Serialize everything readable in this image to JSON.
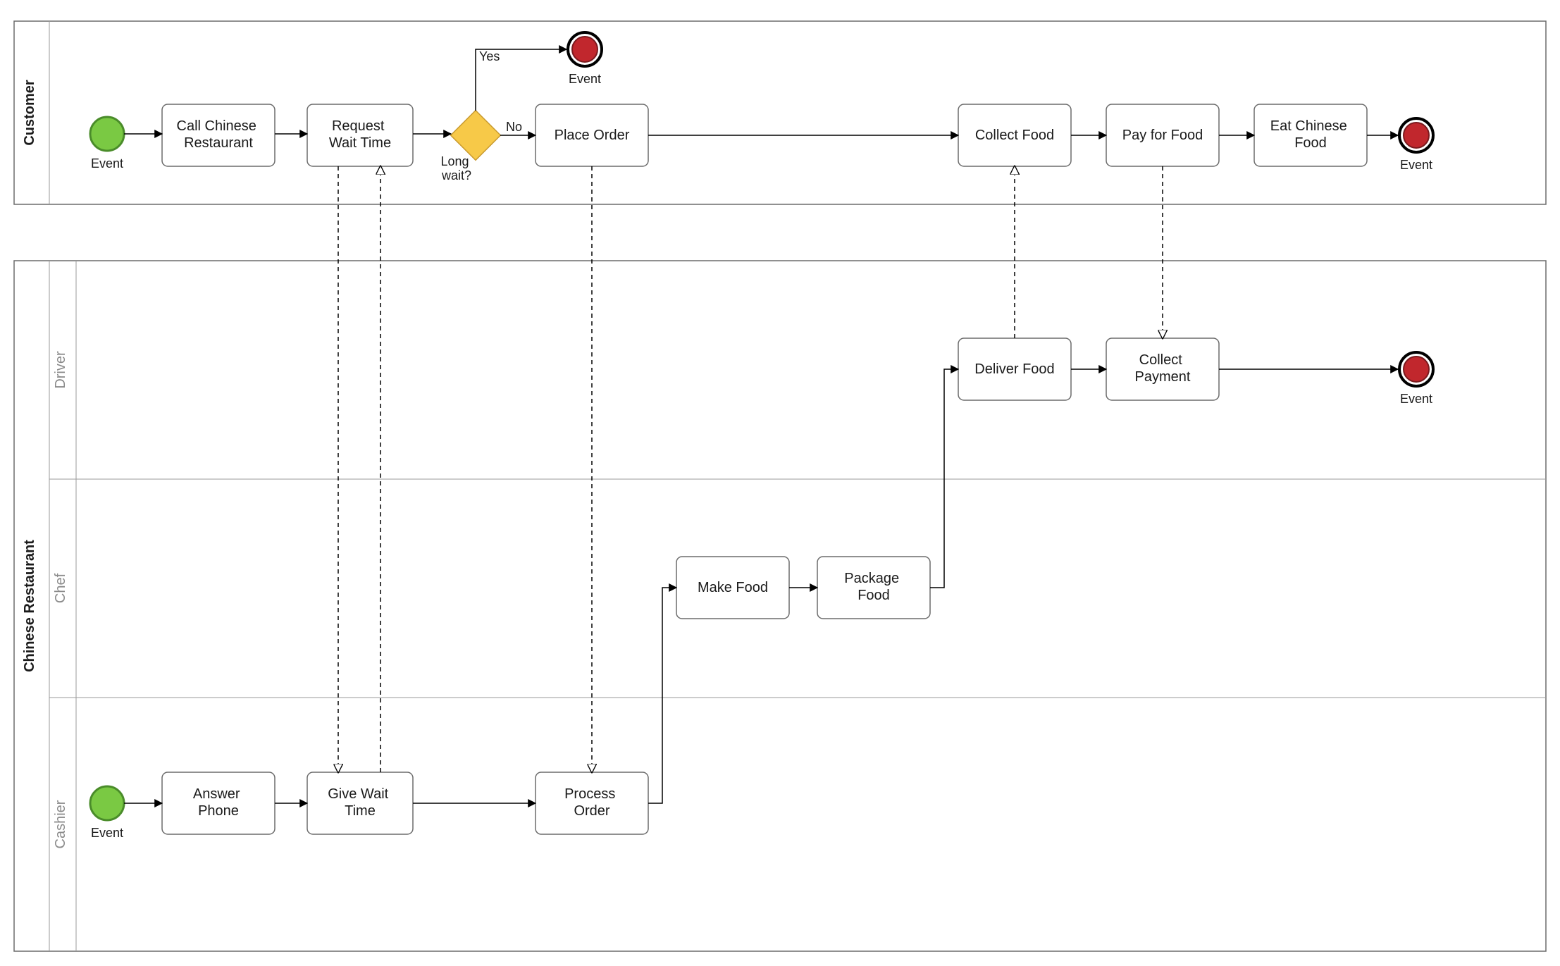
{
  "pools": {
    "customer": {
      "label": "Customer"
    },
    "restaurant": {
      "label": "Chinese Restaurant"
    }
  },
  "lanes": {
    "driver": {
      "label": "Driver"
    },
    "chef": {
      "label": "Chef"
    },
    "cashier": {
      "label": "Cashier"
    }
  },
  "events": {
    "start_customer": "Event",
    "end_customer_early": "Event",
    "end_customer": "Event",
    "end_driver": "Event",
    "start_cashier": "Event"
  },
  "gateway": {
    "long_wait": "Long wait?"
  },
  "flows": {
    "yes": "Yes",
    "no": "No"
  },
  "tasks": {
    "call_rest": "Call Chinese Restaurant",
    "request_wait": "Request Wait Time",
    "place_order": "Place Order",
    "collect_food": "Collect Food",
    "pay_food": "Pay for Food",
    "eat_food": "Eat Chinese Food",
    "deliver_food": "Deliver Food",
    "collect_payment": "Collect Payment",
    "make_food": "Make Food",
    "package_food": "Package Food",
    "answer_phone": "Answer Phone",
    "give_wait": "Give Wait Time",
    "process_order": "Process Order"
  }
}
